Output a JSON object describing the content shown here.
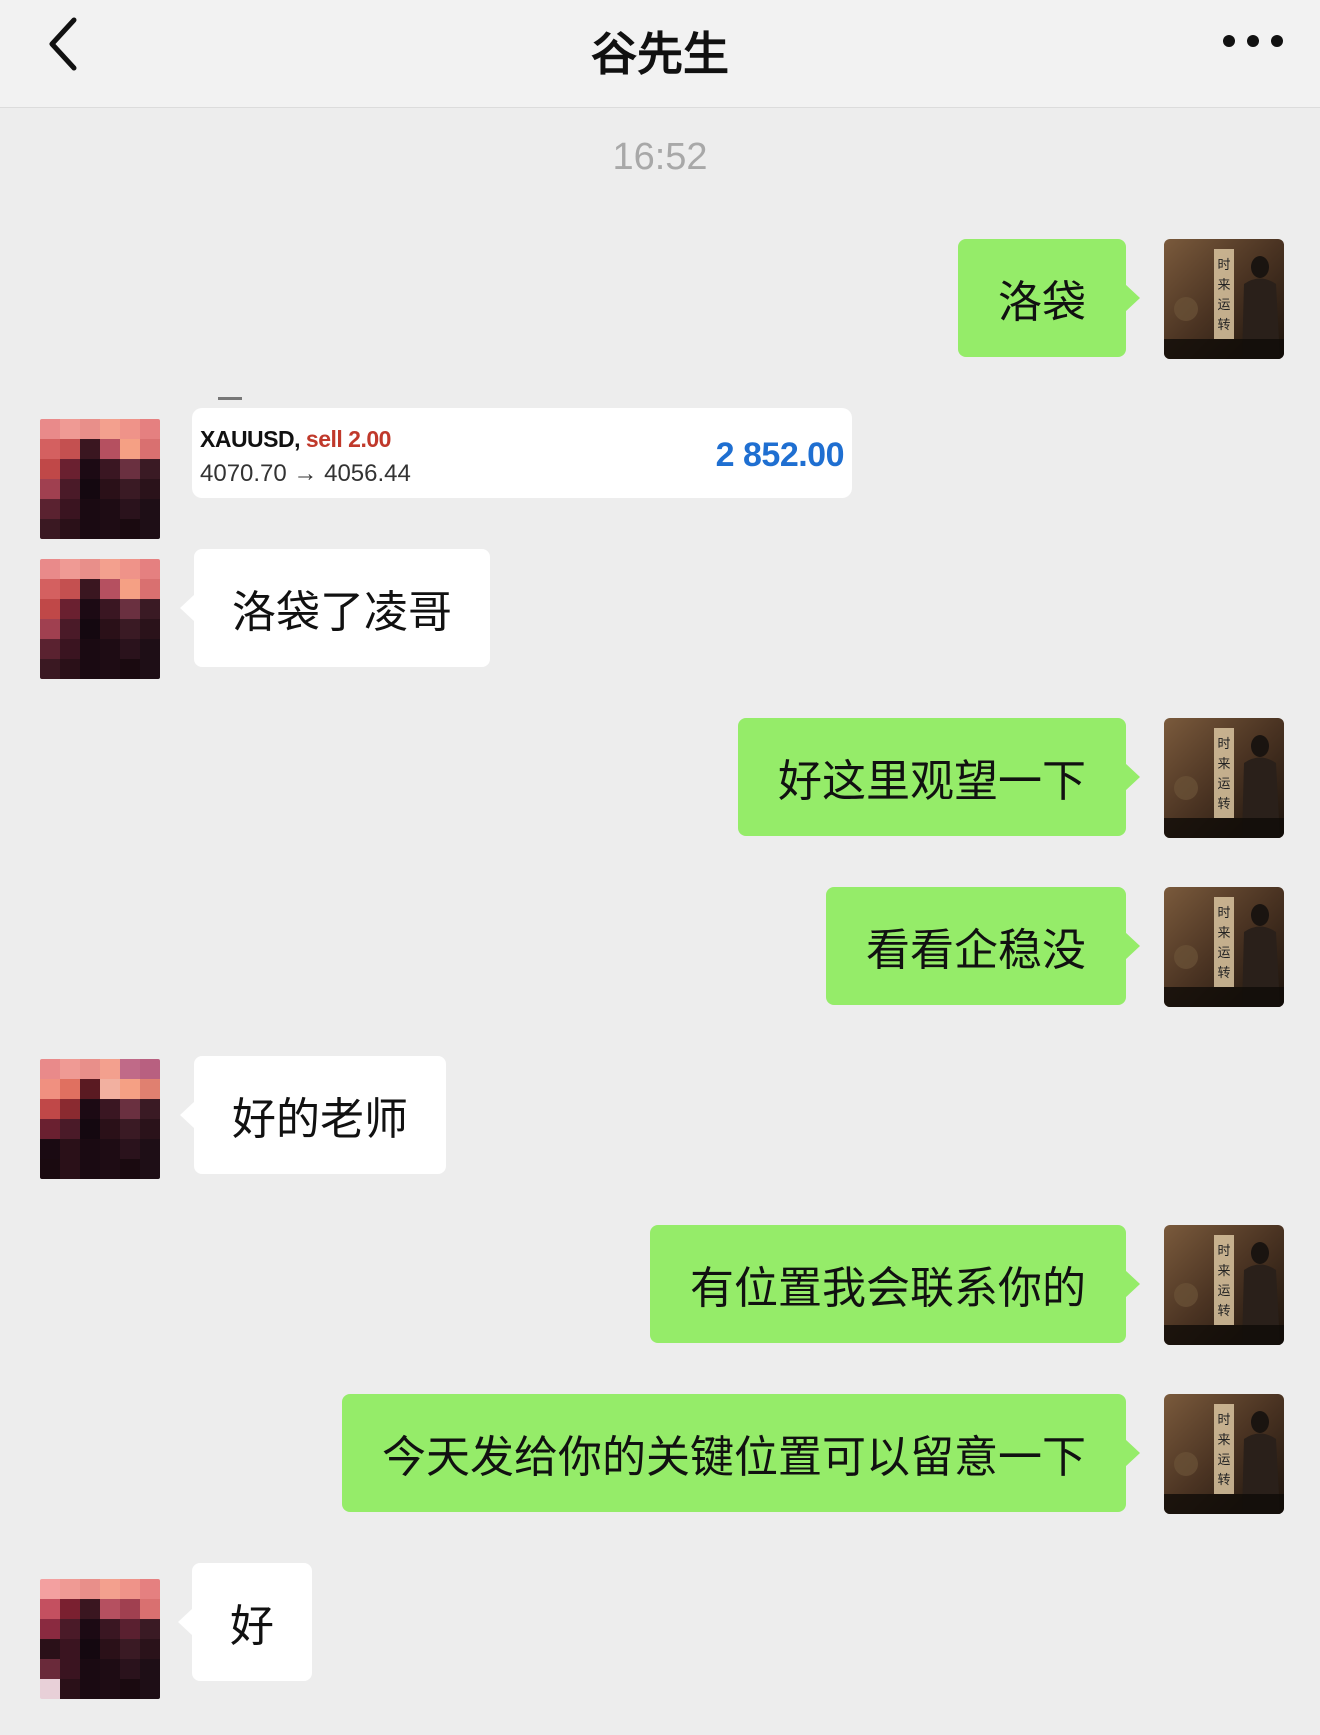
{
  "header": {
    "title": "谷先生"
  },
  "timestamp": "16:52",
  "colors": {
    "my_bubble": "#95ec69",
    "peer_bubble": "#ffffff",
    "background": "#ededed",
    "profit_blue": "#1f6fd1",
    "sell_red": "#c0392b"
  },
  "icons": {
    "back": "chevron-left-icon",
    "more": "more-dots-icon"
  },
  "messages": [
    {
      "from": "me",
      "type": "text",
      "text": "洛袋"
    },
    {
      "from": "peer",
      "type": "trade_card",
      "symbol": "XAUUSD,",
      "side": "sell 2.00",
      "prices": "4070.70 → 4056.44",
      "profit": "2 852.00"
    },
    {
      "from": "peer",
      "type": "text",
      "text": "洛袋了凌哥"
    },
    {
      "from": "me",
      "type": "text",
      "text": "好这里观望一下"
    },
    {
      "from": "me",
      "type": "text",
      "text": "看看企稳没"
    },
    {
      "from": "peer",
      "type": "text",
      "text": "好的老师"
    },
    {
      "from": "me",
      "type": "text",
      "text": "有位置我会联系你的"
    },
    {
      "from": "me",
      "type": "text",
      "text": "今天发给你的关键位置可以留意一下"
    },
    {
      "from": "peer",
      "type": "text",
      "text": "好"
    }
  ],
  "avatar_me_calligraphy": "时来运转"
}
